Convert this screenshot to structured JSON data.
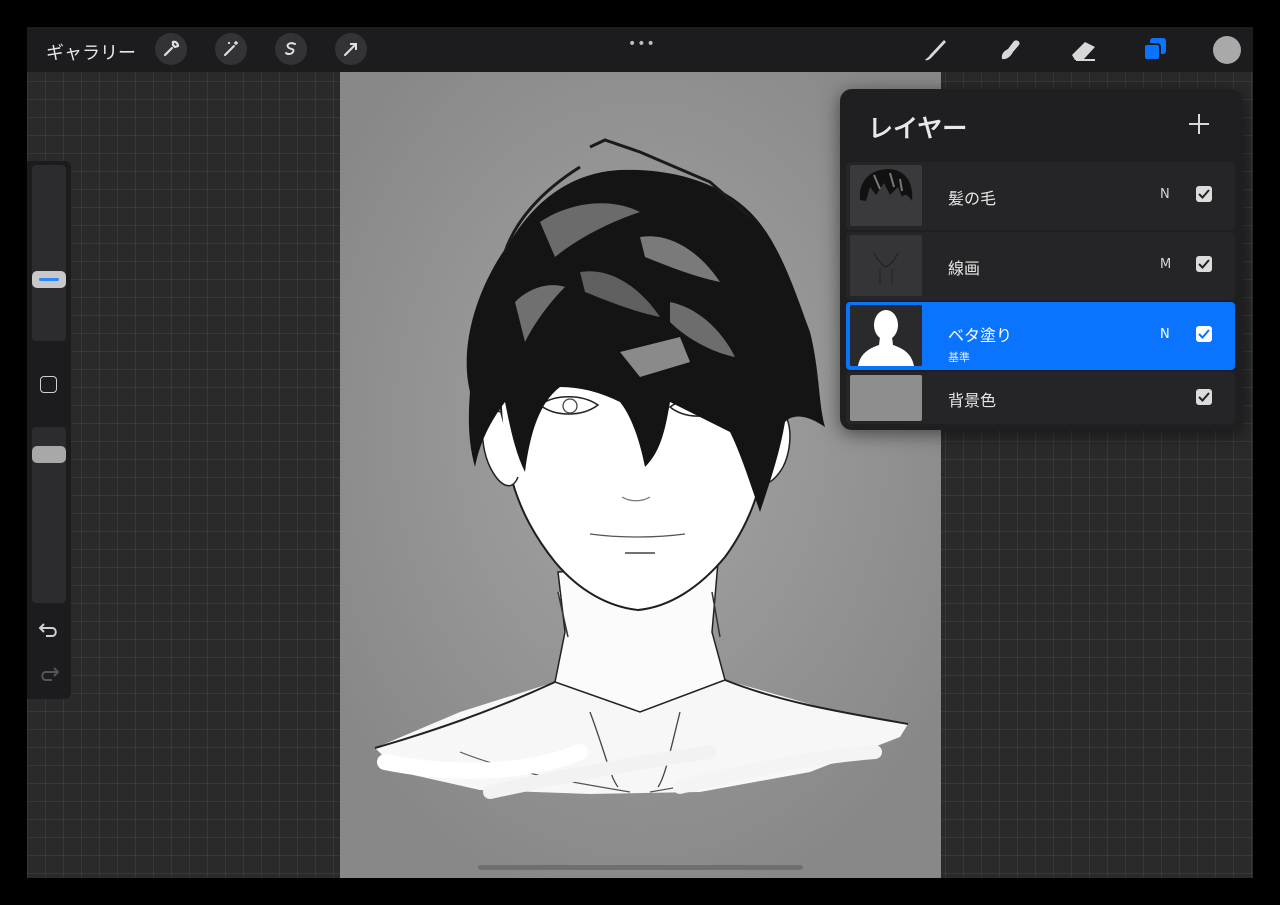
{
  "topbar": {
    "gallery_label": "ギャラリー",
    "left_tools": [
      "wrench-icon",
      "magic-wand-icon",
      "selection-icon",
      "transform-arrow-icon"
    ],
    "more_menu": "•••",
    "right_tools": [
      "brush-icon",
      "smudge-icon",
      "eraser-icon",
      "layers-icon"
    ],
    "accent_color": "#0a74ff",
    "current_color": "#a9a9a9"
  },
  "sidebar": {
    "brush_size_level": 0.22,
    "opacity_level": 0.1,
    "slider_accent": "#2e86ff",
    "undo_icon": "undo-icon",
    "redo_icon": "redo-icon"
  },
  "layers": {
    "title": "レイヤー",
    "add_icon": "plus-icon",
    "items": [
      {
        "name": "髪の毛",
        "blend": "N",
        "visible": true,
        "selected": false
      },
      {
        "name": "線画",
        "blend": "M",
        "visible": true,
        "selected": false
      },
      {
        "name": "ベタ塗り",
        "sublabel": "基準",
        "blend": "N",
        "visible": true,
        "selected": true
      },
      {
        "name": "背景色",
        "blend": "",
        "visible": true,
        "selected": false
      }
    ]
  },
  "canvas": {
    "background": "#8e8e8e"
  }
}
